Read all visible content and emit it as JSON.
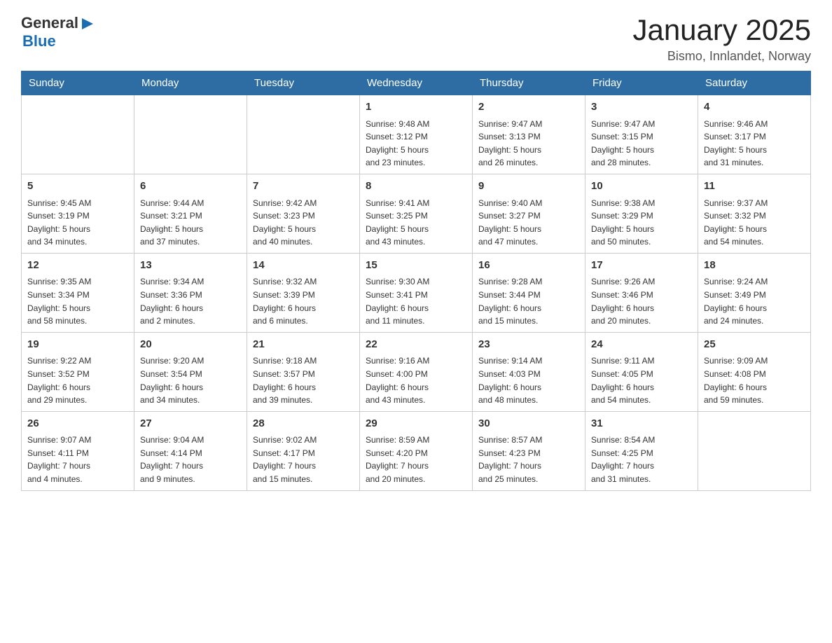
{
  "header": {
    "logo_general": "General",
    "logo_blue": "Blue",
    "month_title": "January 2025",
    "location": "Bismo, Innlandet, Norway"
  },
  "days_of_week": [
    "Sunday",
    "Monday",
    "Tuesday",
    "Wednesday",
    "Thursday",
    "Friday",
    "Saturday"
  ],
  "weeks": [
    {
      "days": [
        {
          "number": "",
          "info": ""
        },
        {
          "number": "",
          "info": ""
        },
        {
          "number": "",
          "info": ""
        },
        {
          "number": "1",
          "info": "Sunrise: 9:48 AM\nSunset: 3:12 PM\nDaylight: 5 hours\nand 23 minutes."
        },
        {
          "number": "2",
          "info": "Sunrise: 9:47 AM\nSunset: 3:13 PM\nDaylight: 5 hours\nand 26 minutes."
        },
        {
          "number": "3",
          "info": "Sunrise: 9:47 AM\nSunset: 3:15 PM\nDaylight: 5 hours\nand 28 minutes."
        },
        {
          "number": "4",
          "info": "Sunrise: 9:46 AM\nSunset: 3:17 PM\nDaylight: 5 hours\nand 31 minutes."
        }
      ]
    },
    {
      "days": [
        {
          "number": "5",
          "info": "Sunrise: 9:45 AM\nSunset: 3:19 PM\nDaylight: 5 hours\nand 34 minutes."
        },
        {
          "number": "6",
          "info": "Sunrise: 9:44 AM\nSunset: 3:21 PM\nDaylight: 5 hours\nand 37 minutes."
        },
        {
          "number": "7",
          "info": "Sunrise: 9:42 AM\nSunset: 3:23 PM\nDaylight: 5 hours\nand 40 minutes."
        },
        {
          "number": "8",
          "info": "Sunrise: 9:41 AM\nSunset: 3:25 PM\nDaylight: 5 hours\nand 43 minutes."
        },
        {
          "number": "9",
          "info": "Sunrise: 9:40 AM\nSunset: 3:27 PM\nDaylight: 5 hours\nand 47 minutes."
        },
        {
          "number": "10",
          "info": "Sunrise: 9:38 AM\nSunset: 3:29 PM\nDaylight: 5 hours\nand 50 minutes."
        },
        {
          "number": "11",
          "info": "Sunrise: 9:37 AM\nSunset: 3:32 PM\nDaylight: 5 hours\nand 54 minutes."
        }
      ]
    },
    {
      "days": [
        {
          "number": "12",
          "info": "Sunrise: 9:35 AM\nSunset: 3:34 PM\nDaylight: 5 hours\nand 58 minutes."
        },
        {
          "number": "13",
          "info": "Sunrise: 9:34 AM\nSunset: 3:36 PM\nDaylight: 6 hours\nand 2 minutes."
        },
        {
          "number": "14",
          "info": "Sunrise: 9:32 AM\nSunset: 3:39 PM\nDaylight: 6 hours\nand 6 minutes."
        },
        {
          "number": "15",
          "info": "Sunrise: 9:30 AM\nSunset: 3:41 PM\nDaylight: 6 hours\nand 11 minutes."
        },
        {
          "number": "16",
          "info": "Sunrise: 9:28 AM\nSunset: 3:44 PM\nDaylight: 6 hours\nand 15 minutes."
        },
        {
          "number": "17",
          "info": "Sunrise: 9:26 AM\nSunset: 3:46 PM\nDaylight: 6 hours\nand 20 minutes."
        },
        {
          "number": "18",
          "info": "Sunrise: 9:24 AM\nSunset: 3:49 PM\nDaylight: 6 hours\nand 24 minutes."
        }
      ]
    },
    {
      "days": [
        {
          "number": "19",
          "info": "Sunrise: 9:22 AM\nSunset: 3:52 PM\nDaylight: 6 hours\nand 29 minutes."
        },
        {
          "number": "20",
          "info": "Sunrise: 9:20 AM\nSunset: 3:54 PM\nDaylight: 6 hours\nand 34 minutes."
        },
        {
          "number": "21",
          "info": "Sunrise: 9:18 AM\nSunset: 3:57 PM\nDaylight: 6 hours\nand 39 minutes."
        },
        {
          "number": "22",
          "info": "Sunrise: 9:16 AM\nSunset: 4:00 PM\nDaylight: 6 hours\nand 43 minutes."
        },
        {
          "number": "23",
          "info": "Sunrise: 9:14 AM\nSunset: 4:03 PM\nDaylight: 6 hours\nand 48 minutes."
        },
        {
          "number": "24",
          "info": "Sunrise: 9:11 AM\nSunset: 4:05 PM\nDaylight: 6 hours\nand 54 minutes."
        },
        {
          "number": "25",
          "info": "Sunrise: 9:09 AM\nSunset: 4:08 PM\nDaylight: 6 hours\nand 59 minutes."
        }
      ]
    },
    {
      "days": [
        {
          "number": "26",
          "info": "Sunrise: 9:07 AM\nSunset: 4:11 PM\nDaylight: 7 hours\nand 4 minutes."
        },
        {
          "number": "27",
          "info": "Sunrise: 9:04 AM\nSunset: 4:14 PM\nDaylight: 7 hours\nand 9 minutes."
        },
        {
          "number": "28",
          "info": "Sunrise: 9:02 AM\nSunset: 4:17 PM\nDaylight: 7 hours\nand 15 minutes."
        },
        {
          "number": "29",
          "info": "Sunrise: 8:59 AM\nSunset: 4:20 PM\nDaylight: 7 hours\nand 20 minutes."
        },
        {
          "number": "30",
          "info": "Sunrise: 8:57 AM\nSunset: 4:23 PM\nDaylight: 7 hours\nand 25 minutes."
        },
        {
          "number": "31",
          "info": "Sunrise: 8:54 AM\nSunset: 4:25 PM\nDaylight: 7 hours\nand 31 minutes."
        },
        {
          "number": "",
          "info": ""
        }
      ]
    }
  ]
}
